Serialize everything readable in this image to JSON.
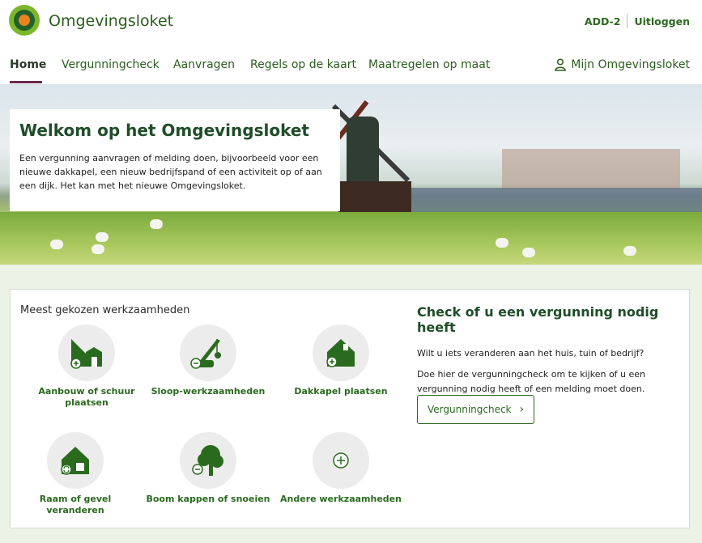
{
  "header": {
    "brand": "Omgevingsloket",
    "user_code": "ADD-2",
    "logout": "Uitloggen"
  },
  "nav": {
    "items": [
      "Home",
      "Vergunningcheck",
      "Aanvragen",
      "Regels op de kaart",
      "Maatregelen op maat"
    ],
    "account": "Mijn Omgevingsloket"
  },
  "hero": {
    "title": "Welkom op het Omgevingsloket",
    "text": "Een vergunning aanvragen of melding doen, bijvoorbeeld voor een nieuwe dakkapel, een nieuw bedrijfspand of een activiteit op of aan een dijk. Het kan met het nieuwe Omgevingsloket."
  },
  "tasks": {
    "heading": "Meest gekozen werkzaamheden",
    "items": [
      {
        "label": "Aanbouw of schuur plaatsen",
        "icon": "shed-icon"
      },
      {
        "label": "Sloop-werkzaamheden",
        "icon": "crane-icon"
      },
      {
        "label": "Dakkapel plaatsen",
        "icon": "house-plus-icon"
      },
      {
        "label": "Raam of gevel veranderen",
        "icon": "house-refresh-icon"
      },
      {
        "label": "Boom kappen of snoeien",
        "icon": "tree-icon"
      },
      {
        "label": "Andere werkzaamheden",
        "icon": "plus-icon"
      }
    ]
  },
  "check": {
    "title": "Check of u een vergunning nodig heeft",
    "para1": "Wilt u iets veranderen aan het huis, tuin of bedrijf?",
    "para2": "Doe hier de vergunningcheck om te kijken of u een vergunning nodig heeft of een melding moet doen.",
    "button": "Vergunningcheck"
  },
  "colors": {
    "brand_green": "#2a6a1e",
    "dark_green": "#1f4d29",
    "nav_underline": "#6b2a52",
    "page_bg": "#eaf3e6"
  }
}
